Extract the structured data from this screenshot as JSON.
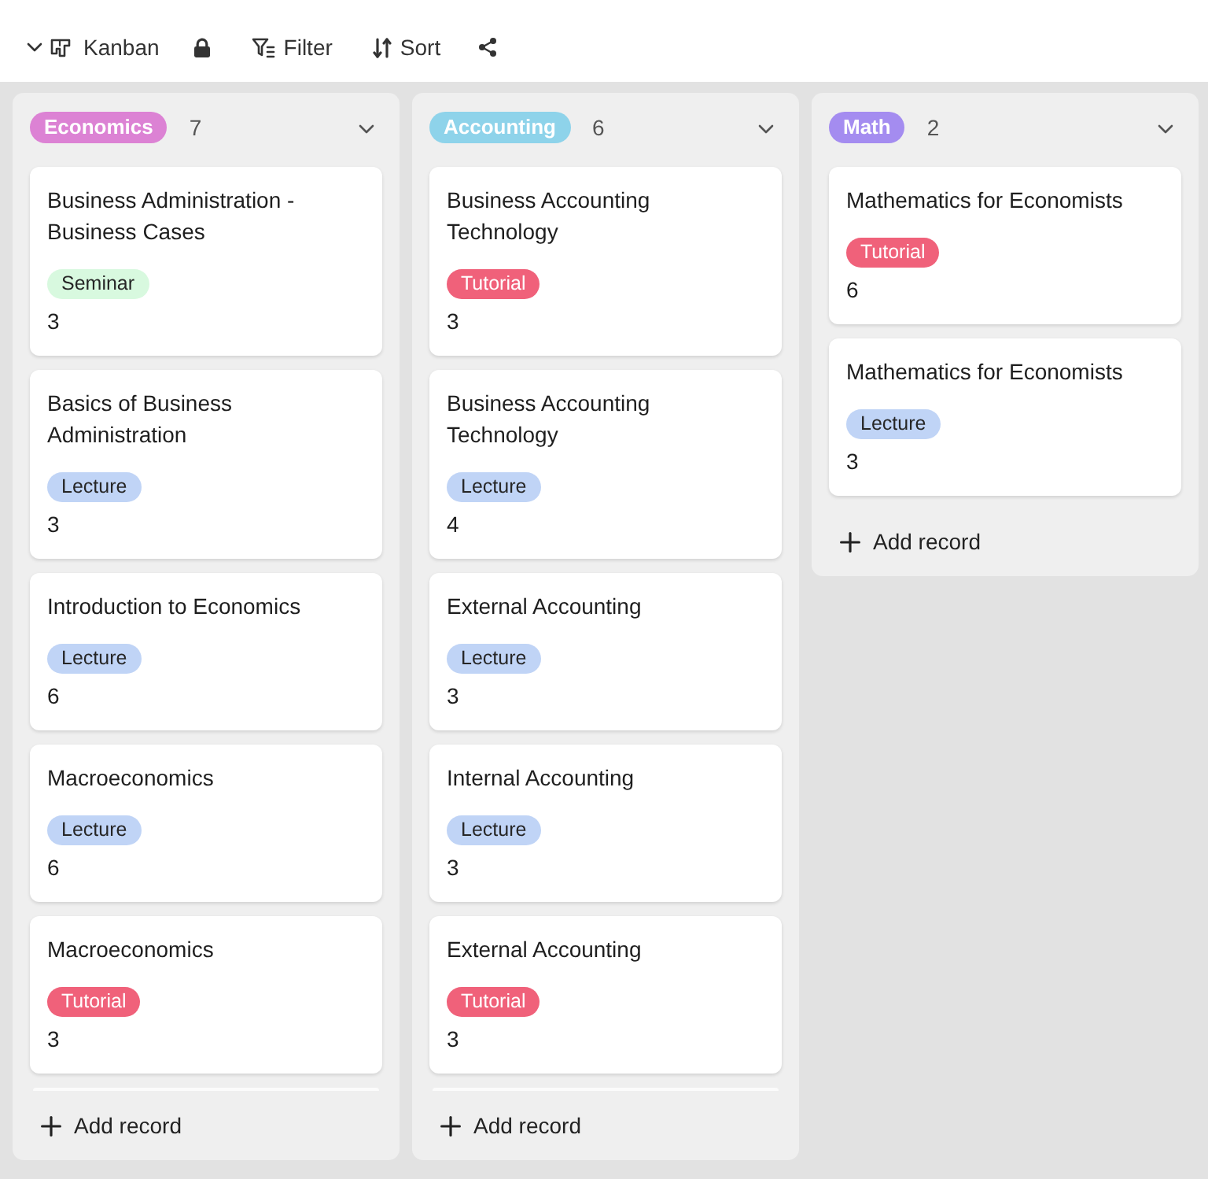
{
  "toolbar": {
    "view_label": "Kanban",
    "actions": [
      {
        "kind": "filter",
        "label": "Filter"
      },
      {
        "kind": "sort",
        "label": "Sort"
      }
    ]
  },
  "columns": [
    {
      "title": "Economics",
      "color": "#dc82d4",
      "count": "7",
      "cards": [
        {
          "title": "Business Administration - Business Cases",
          "tag": {
            "label": "Seminar",
            "color": "#d8f9df"
          },
          "value": "3"
        },
        {
          "title": "Basics of Business Administration",
          "tag": {
            "label": "Lecture",
            "color": "#c0d4f6"
          },
          "value": "3"
        },
        {
          "title": "Introduction to Economics",
          "tag": {
            "label": "Lecture",
            "color": "#c0d4f6"
          },
          "value": "6"
        },
        {
          "title": "Macroeconomics",
          "tag": {
            "label": "Lecture",
            "color": "#c0d4f6"
          },
          "value": "6"
        },
        {
          "title": "Macroeconomics",
          "tag": {
            "label": "Tutorial",
            "color": "#f0617a"
          },
          "value": "3"
        }
      ],
      "add_label": "Add record"
    },
    {
      "title": "Accounting",
      "color": "#8ed3ea",
      "count": "6",
      "cards": [
        {
          "title": "Business Accounting Technology",
          "tag": {
            "label": "Tutorial",
            "color": "#f0617a"
          },
          "value": "3"
        },
        {
          "title": "Business Accounting Technology",
          "tag": {
            "label": "Lecture",
            "color": "#c0d4f6"
          },
          "value": "4"
        },
        {
          "title": "External Accounting",
          "tag": {
            "label": "Lecture",
            "color": "#c0d4f6"
          },
          "value": "3"
        },
        {
          "title": "Internal Accounting",
          "tag": {
            "label": "Lecture",
            "color": "#c0d4f6"
          },
          "value": "3"
        },
        {
          "title": "External Accounting",
          "tag": {
            "label": "Tutorial",
            "color": "#f0617a"
          },
          "value": "3"
        }
      ],
      "add_label": "Add record"
    },
    {
      "title": "Math",
      "color": "#a48cf0",
      "count": "2",
      "cards": [
        {
          "title": "Mathematics for Economists",
          "tag": {
            "label": "Tutorial",
            "color": "#f0617a"
          },
          "value": "6"
        },
        {
          "title": "Mathematics for Economists",
          "tag": {
            "label": "Lecture",
            "color": "#c0d4f6"
          },
          "value": "3"
        }
      ],
      "add_label": "Add record"
    }
  ]
}
